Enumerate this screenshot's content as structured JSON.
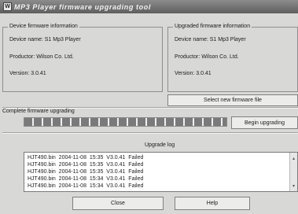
{
  "window": {
    "title": "MP3 Player firmware upgrading tool",
    "icon_text": "W"
  },
  "device_info": {
    "legend": "Device firmware information",
    "device_name": "Device name: S1 Mp3 Player",
    "productor": "Productor: Wilson Co. Ltd.",
    "version": "Version: 3.0.41"
  },
  "upgraded_info": {
    "legend": "Upgraded firmware information",
    "device_name": "Device name: S1 Mp3 Player",
    "productor": "Productor: Wilson Co. Ltd.",
    "version": "Version: 3.0.41"
  },
  "select_file_button": "Select new firmware file",
  "progress": {
    "label": "Complete firmware upgrading",
    "fraction": 1.0
  },
  "begin_button": "Begin upgrading",
  "log": {
    "title": "Upgrade log",
    "lines": [
      "HJT490.bin  2004-11-08  15:35  V3.0.41  Failed",
      "HJT490.bin  2004-11-08  15:35  V3.0.41  Failed",
      "HJT490.bin  2004-11-08  15:35  V3.0.41  Failed",
      "HJT490.bin  2004-11-08  15:34  V3.0.41  Failed",
      "HJT490.bin  2004-11-08  15:34  V3.0.41  Failed"
    ]
  },
  "buttons": {
    "close": "Close",
    "help": "Help"
  }
}
